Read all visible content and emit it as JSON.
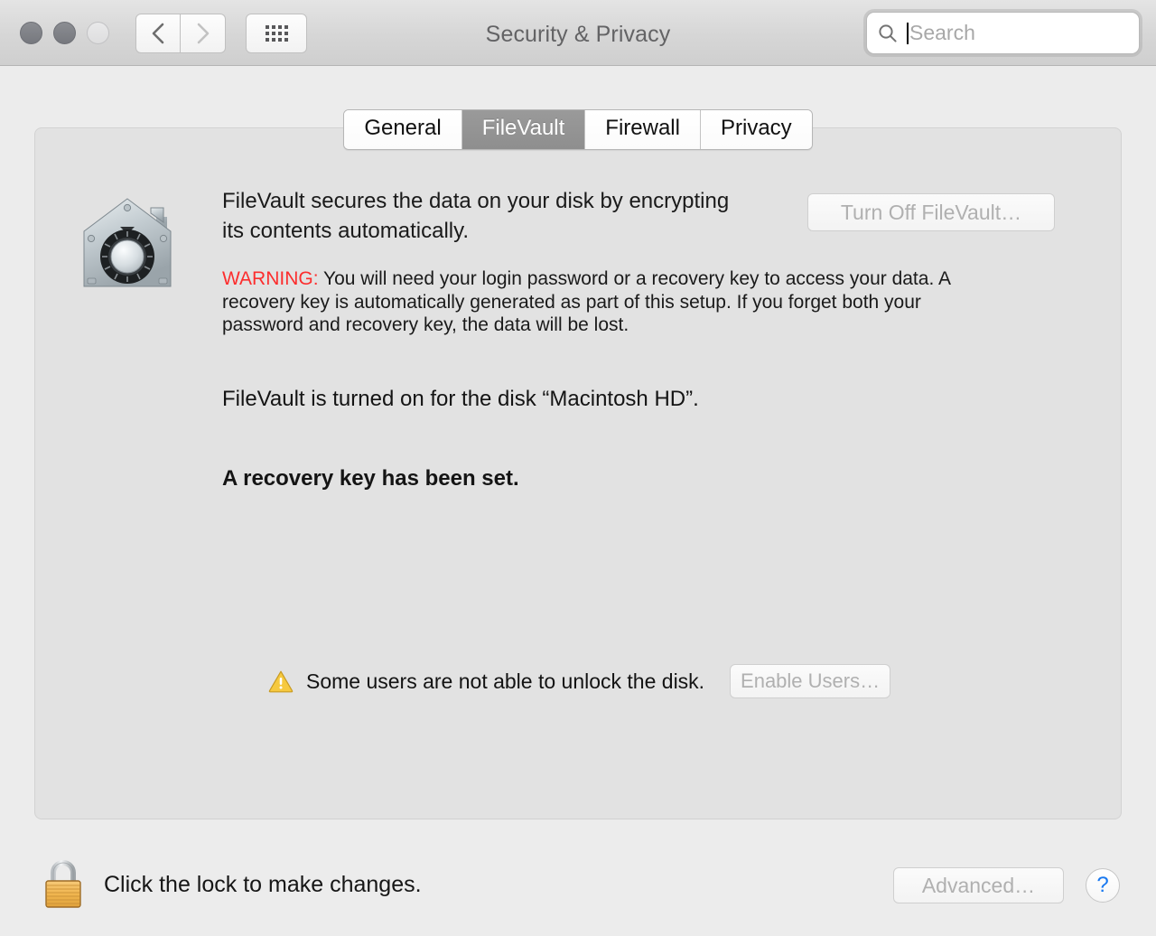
{
  "window": {
    "title": "Security & Privacy",
    "traffic_lights": [
      "close",
      "minimize",
      "zoom"
    ],
    "nav": {
      "back_icon": "chevron-left-icon",
      "forward_icon": "chevron-right-icon",
      "grid_icon": "grid-view-icon"
    }
  },
  "search": {
    "placeholder": "Search",
    "value": "",
    "icon": "search-icon"
  },
  "tabs": [
    {
      "label": "General",
      "active": false
    },
    {
      "label": "FileVault",
      "active": true
    },
    {
      "label": "Firewall",
      "active": false
    },
    {
      "label": "Privacy",
      "active": false
    }
  ],
  "filevault": {
    "icon": "filevault-vault-icon",
    "intro": "FileVault secures the data on your disk by encrypting its contents automatically.",
    "warning_label": "WARNING:",
    "warning_body": "You will need your login password or a recovery key to access your data. A recovery key is automatically generated as part of this setup. If you forget both your password and recovery key, the data will be lost.",
    "warning_color": "#fc2d2d",
    "status_line": "FileVault is turned on for the disk “Macintosh HD”.",
    "recovery_key_line": "A recovery key has been set.",
    "turn_off_button": "Turn Off FileVault…",
    "turn_off_disabled": true,
    "users_warning_icon": "warning-triangle-icon",
    "users_warning_text": "Some users are not able to unlock the disk.",
    "enable_users_button": "Enable Users…",
    "enable_users_disabled": true
  },
  "footer": {
    "lock_icon": "lock-closed-icon",
    "lock_text": "Click the lock to make changes.",
    "advanced_button": "Advanced…",
    "advanced_disabled": true,
    "help_button": "?"
  }
}
